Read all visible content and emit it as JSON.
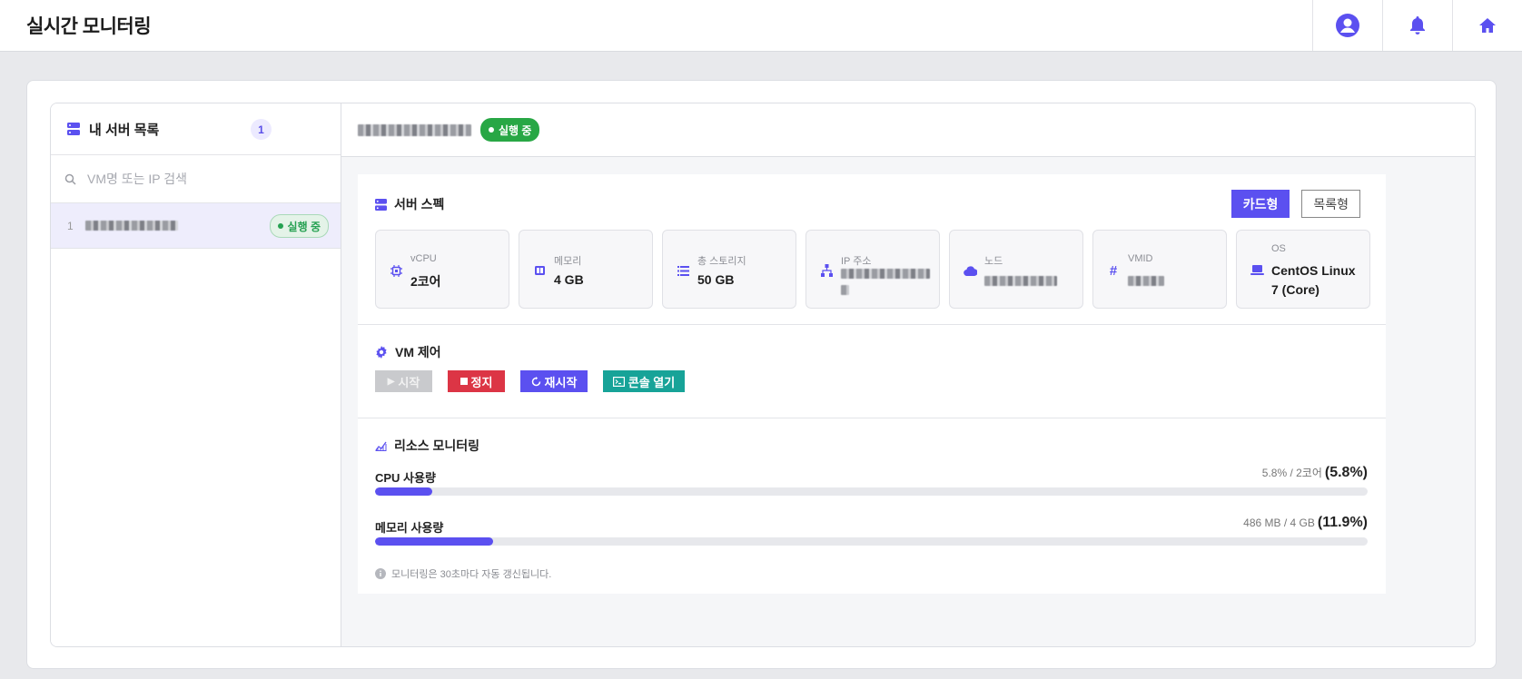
{
  "app": {
    "title": "실시간 모니터링"
  },
  "sidebar": {
    "title": "내 서버 목록",
    "count": "1",
    "search_placeholder": "VM명 또는 IP 검색",
    "items": [
      {
        "index": "1",
        "status": "실행 중"
      }
    ]
  },
  "header": {
    "status": "실행 중"
  },
  "spec": {
    "title": "서버 스펙",
    "view_card": "카드형",
    "view_list": "목록형",
    "cards": [
      {
        "label": "vCPU",
        "value": "2코어",
        "icon": "cpu-icon"
      },
      {
        "label": "메모리",
        "value": "4 GB",
        "icon": "memory-icon"
      },
      {
        "label": "총 스토리지",
        "value": "50 GB",
        "icon": "storage-icon"
      },
      {
        "label": "IP 주소",
        "value": "",
        "icon": "network-icon"
      },
      {
        "label": "노드",
        "value": "",
        "icon": "cloud-icon"
      },
      {
        "label": "VMID",
        "value": "",
        "icon": "hash-icon"
      },
      {
        "label": "OS",
        "value": "CentOS Linux 7 (Core)",
        "icon": "laptop-icon"
      }
    ]
  },
  "control": {
    "title": "VM 제어",
    "start": "시작",
    "stop": "정지",
    "restart": "재시작",
    "console": "콘솔 열기"
  },
  "monitor": {
    "title": "리소스 모니터링",
    "cpu": {
      "label": "CPU 사용량",
      "detail": "5.8% / 2코어",
      "percent_text": "(5.8%)",
      "percent": 5.8
    },
    "memory": {
      "label": "메모리 사용량",
      "detail": "486 MB / 4 GB",
      "percent_text": "(11.9%)",
      "percent": 11.9
    },
    "note": "모니터링은 30초마다 자동 갱신됩니다."
  },
  "colors": {
    "accent": "#5b50f0",
    "success": "#28a745",
    "danger": "#dc3545",
    "teal": "#17a398"
  }
}
